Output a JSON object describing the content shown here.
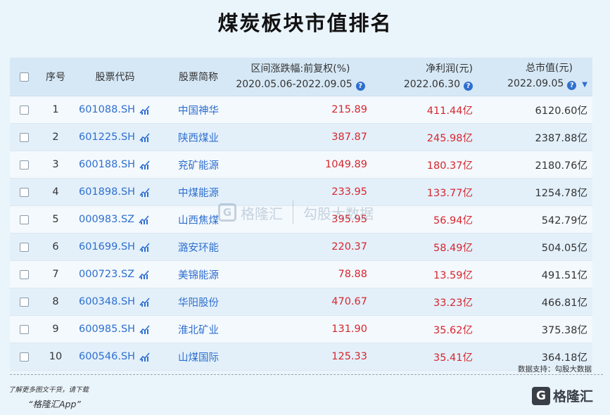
{
  "title": "煤炭板块市值排名",
  "header": {
    "no": "序号",
    "code": "股票代码",
    "name": "股票简称",
    "chg_line1": "区间涨跌幅:前复权(%)",
    "chg_line2": "2020.05.06-2022.09.05",
    "profit_line1": "净利润(元)",
    "profit_line2": "2022.06.30",
    "cap_line1": "总市值(元)",
    "cap_line2": "2022.09.05",
    "sort_icon": "▼"
  },
  "rows": [
    {
      "no": "1",
      "code": "601088.SH",
      "name": "中国神华",
      "chg": "215.89",
      "profit": "411.44亿",
      "cap": "6120.60亿"
    },
    {
      "no": "2",
      "code": "601225.SH",
      "name": "陕西煤业",
      "chg": "387.87",
      "profit": "245.98亿",
      "cap": "2387.88亿"
    },
    {
      "no": "3",
      "code": "600188.SH",
      "name": "兖矿能源",
      "chg": "1049.89",
      "profit": "180.37亿",
      "cap": "2180.76亿"
    },
    {
      "no": "4",
      "code": "601898.SH",
      "name": "中煤能源",
      "chg": "233.95",
      "profit": "133.77亿",
      "cap": "1254.78亿"
    },
    {
      "no": "5",
      "code": "000983.SZ",
      "name": "山西焦煤",
      "chg": "395.95",
      "profit": "56.94亿",
      "cap": "542.79亿"
    },
    {
      "no": "6",
      "code": "601699.SH",
      "name": "潞安环能",
      "chg": "220.37",
      "profit": "58.49亿",
      "cap": "504.05亿"
    },
    {
      "no": "7",
      "code": "000723.SZ",
      "name": "美锦能源",
      "chg": "78.88",
      "profit": "13.59亿",
      "cap": "491.51亿"
    },
    {
      "no": "8",
      "code": "600348.SH",
      "name": "华阳股份",
      "chg": "470.67",
      "profit": "33.23亿",
      "cap": "466.81亿"
    },
    {
      "no": "9",
      "code": "600985.SH",
      "name": "淮北矿业",
      "chg": "131.90",
      "profit": "35.62亿",
      "cap": "375.38亿"
    },
    {
      "no": "10",
      "code": "600546.SH",
      "name": "山煤国际",
      "chg": "125.33",
      "profit": "35.41亿",
      "cap": "364.18亿"
    }
  ],
  "watermark": {
    "logo_letter": "G",
    "brand": "格隆汇",
    "sub": "勾股大数据"
  },
  "source": "数据支持：勾股大数据",
  "promo": {
    "line1": "了解更多图文干货，请下载",
    "line2": "“格隆汇App”"
  },
  "brand": {
    "logo_letter": "G",
    "name": "格隆汇"
  },
  "colors": {
    "accent": "#2f6fcf",
    "positive": "#d6262e",
    "header_bg": "#d6e8f6"
  }
}
